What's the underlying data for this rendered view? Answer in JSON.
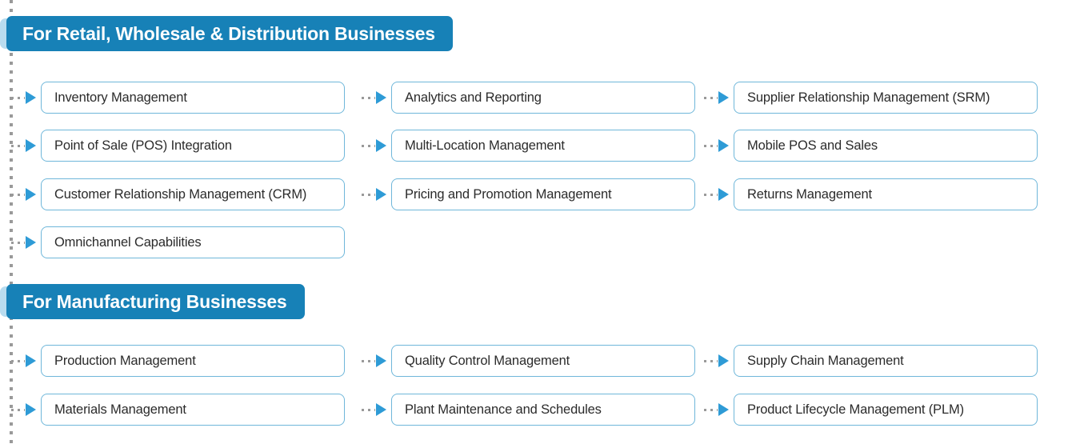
{
  "diagram": {
    "title_visible": false,
    "colors": {
      "header_blue": "#1781B7",
      "header_nub_blue": "#B9DCEF",
      "box_border_blue": "#6FB7DA",
      "arrow_blue": "#2E9BD6",
      "dot_gray": "#9a9a9a",
      "text_dark": "#2b2b2b",
      "background": "#ffffff"
    },
    "sections": [
      {
        "id": "retail",
        "header": "For Retail, Wholesale & Distribution Businesses",
        "rows": [
          {
            "cells": [
              "Inventory Management",
              "Analytics and Reporting",
              "Supplier Relationship Management (SRM)"
            ]
          },
          {
            "cells": [
              "Point of Sale (POS) Integration",
              "Multi-Location Management",
              "Mobile POS and Sales"
            ]
          },
          {
            "cells": [
              "Customer Relationship Management (CRM)",
              "Pricing and Promotion Management",
              "Returns Management"
            ]
          },
          {
            "cells": [
              "Omnichannel Capabilities"
            ]
          }
        ]
      },
      {
        "id": "manufacturing",
        "header": "For Manufacturing Businesses",
        "rows": [
          {
            "cells": [
              "Production Management",
              "Quality Control Management",
              "Supply Chain Management"
            ]
          },
          {
            "cells": [
              "Materials Management",
              "Plant Maintenance and Schedules",
              "Product Lifecycle Management (PLM)"
            ]
          }
        ]
      }
    ]
  }
}
